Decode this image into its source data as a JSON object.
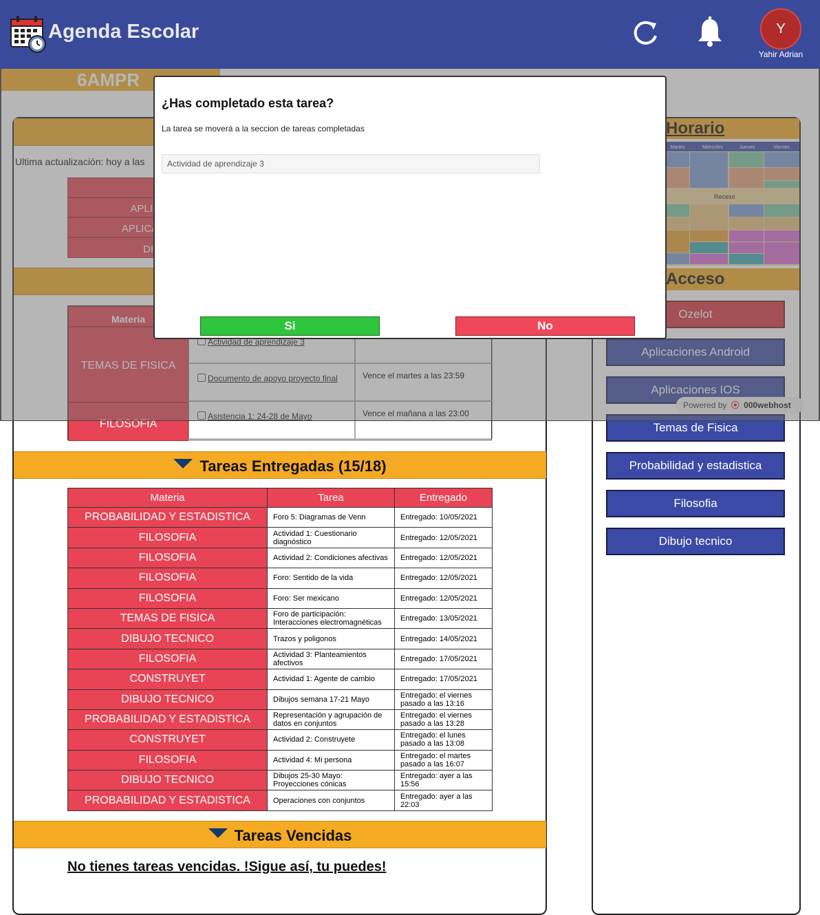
{
  "header": {
    "app_title": "Agenda Escolar",
    "group": "6AMPR",
    "user_initial": "Y",
    "user_name": "Yahir Adrian",
    "accent_color": "#3a4a9a"
  },
  "pending": {
    "last_update": "Ultima actualización: hoy a las",
    "top_rows": [
      "",
      "APLICA",
      "APLICACI",
      "DIBU"
    ],
    "col_materia": "Materia",
    "rows": [
      {
        "materia": "TEMAS DE FISICA",
        "task": "Actividad de aprendizaje 3",
        "due": ""
      },
      {
        "materia": "",
        "task": "Documento de apoyo proyecto final",
        "due": "Vence el martes a las 23:59"
      },
      {
        "materia": "FILOSOFIA",
        "task": "Asistencia 1: 24-28 de Mayo",
        "due": "Vence el mañana a las 23:00"
      }
    ]
  },
  "delivered": {
    "title": "Tareas Entregadas (15/18)",
    "headers": [
      "Materia",
      "Tarea",
      "Entregado"
    ],
    "rows": [
      {
        "materia": "PROBABILIDAD Y ESTADISTICA",
        "tarea": "Foro 5: Diagramas de Venn",
        "entregado": "Entregado: 10/05/2021"
      },
      {
        "materia": "FILOSOFIA",
        "tarea": "Actividad 1: Cuestionario diagnóstico",
        "entregado": "Entregado: 12/05/2021"
      },
      {
        "materia": "FILOSOFIA",
        "tarea": "Actividad 2: Condiciones afectivas",
        "entregado": "Entregado: 12/05/2021"
      },
      {
        "materia": "FILOSOFIA",
        "tarea": "Foro: Sentido de la vida",
        "entregado": "Entregado: 12/05/2021"
      },
      {
        "materia": "FILOSOFIA",
        "tarea": "Foro: Ser mexicano",
        "entregado": "Entregado: 12/05/2021"
      },
      {
        "materia": "TEMAS DE FISICA",
        "tarea": "Foro de participación: Interacciones electromagnéticas",
        "entregado": "Entregado: 13/05/2021"
      },
      {
        "materia": "DIBUJO TECNICO",
        "tarea": "Trazos y poligonos",
        "entregado": "Entregado: 14/05/2021"
      },
      {
        "materia": "FILOSOFIA",
        "tarea": "Actividad 3: Planteamientos afectivos",
        "entregado": "Entregado: 17/05/2021"
      },
      {
        "materia": "CONSTRUYET",
        "tarea": "Actividad 1: Agente de cambio",
        "entregado": "Entregado: 17/05/2021"
      },
      {
        "materia": "DIBUJO TECNICO",
        "tarea": "Dibujos semana 17-21 Mayo",
        "entregado": "Entregado: el viernes pasado a las 13:16"
      },
      {
        "materia": "PROBABILIDAD Y ESTADISTICA",
        "tarea": "Representación y agrupación de datos en conjuntos",
        "entregado": "Entregado: el viernes pasado a las 13:28"
      },
      {
        "materia": "CONSTRUYET",
        "tarea": "Actividad 2: Construyete",
        "entregado": "Entregado: el lunes pasado a las 13:08"
      },
      {
        "materia": "FILOSOFIA",
        "tarea": "Actividad 4: Mi persona",
        "entregado": "Entregado: el martes pasado a las 16:07"
      },
      {
        "materia": "DIBUJO TECNICO",
        "tarea": "Dibujos 25-30 Mayo: Proyecciones cónicas",
        "entregado": "Entregado: ayer a las 15:56"
      },
      {
        "materia": "PROBABILIDAD Y ESTADISTICA",
        "tarea": "Operaciones con conjuntos",
        "entregado": "Entregado: ayer a las 22:03"
      }
    ]
  },
  "overdue": {
    "title": "Tareas Vencidas",
    "message": "No tienes tareas vencidas. !Sigue así, tu puedes!"
  },
  "sidebar": {
    "horario_title": "Horario",
    "schedule_days": [
      "Martes",
      "Miércoles",
      "Jueves",
      "Viernes"
    ],
    "schedule_break": "Receso",
    "acceso_title": "Acceso",
    "links": [
      "Ozelot",
      "Aplicaciones Android",
      "Aplicaciones IOS",
      "Temas de Fisica",
      "Probabilidad y estadistica",
      "Filosofia",
      "Dibujo tecnico"
    ],
    "powered_by": "Powered by",
    "powered_brand": "000webhost"
  },
  "modal": {
    "title": "¿Has completado esta tarea?",
    "message": "La tarea se moverá a la seccion de tareas completadas",
    "task_value": "Actividad de aprendizaje 3",
    "yes_label": "Si",
    "no_label": "No"
  }
}
